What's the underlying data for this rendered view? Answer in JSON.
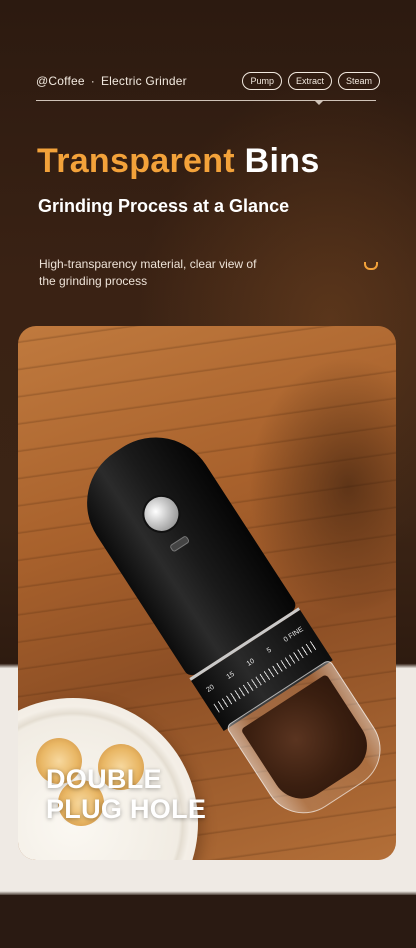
{
  "header": {
    "brand": "@Coffee",
    "separator": "·",
    "product": "Electric Grinder",
    "tags": [
      "Pump",
      "Extract",
      "Steam"
    ]
  },
  "hero": {
    "title_accent": "Transparent",
    "title_rest": "Bins",
    "subtitle_main": "Grinding Process at a Glan",
    "subtitle_last": "ce",
    "description": "High-transparency material, clear view of the grinding process"
  },
  "grinder_scale": [
    "20",
    "15",
    "10",
    "5",
    "0 FINE"
  ],
  "caption": {
    "line1": "DOUBLE",
    "line2": "PLUG HOLE"
  },
  "colors": {
    "accent": "#f3a23a",
    "background_dark": "#2c1a10",
    "background_light": "#efeae4"
  }
}
